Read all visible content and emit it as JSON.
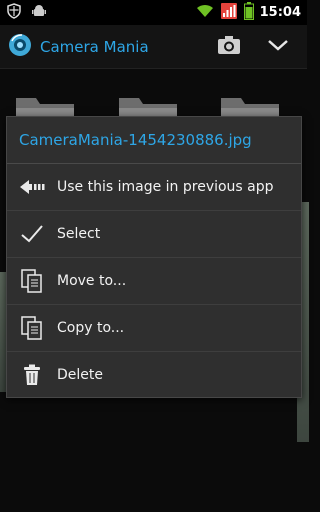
{
  "status_bar": {
    "time": "15:04",
    "icons": [
      "shield-icon",
      "android-debug-icon",
      "wifi-icon",
      "signal-icon",
      "battery-icon"
    ]
  },
  "action_bar": {
    "title": "Camera Mania",
    "icons": [
      "app-logo-icon",
      "camera-icon",
      "chevron-down-icon"
    ]
  },
  "context_menu": {
    "title": "CameraMania-1454230886.jpg",
    "items": [
      {
        "label": "Use this image in previous app",
        "icon": "back-arrow-icon"
      },
      {
        "label": "Select",
        "icon": "checkmark-icon"
      },
      {
        "label": "Move to...",
        "icon": "move-copy-icon"
      },
      {
        "label": "Copy to...",
        "icon": "copy-icon"
      },
      {
        "label": "Delete",
        "icon": "trash-icon"
      }
    ]
  },
  "colors": {
    "accent": "#2ea6e6",
    "menu_bg": "#2f2f2f",
    "battery": "#e4433c",
    "wifi": "#6fc124"
  }
}
